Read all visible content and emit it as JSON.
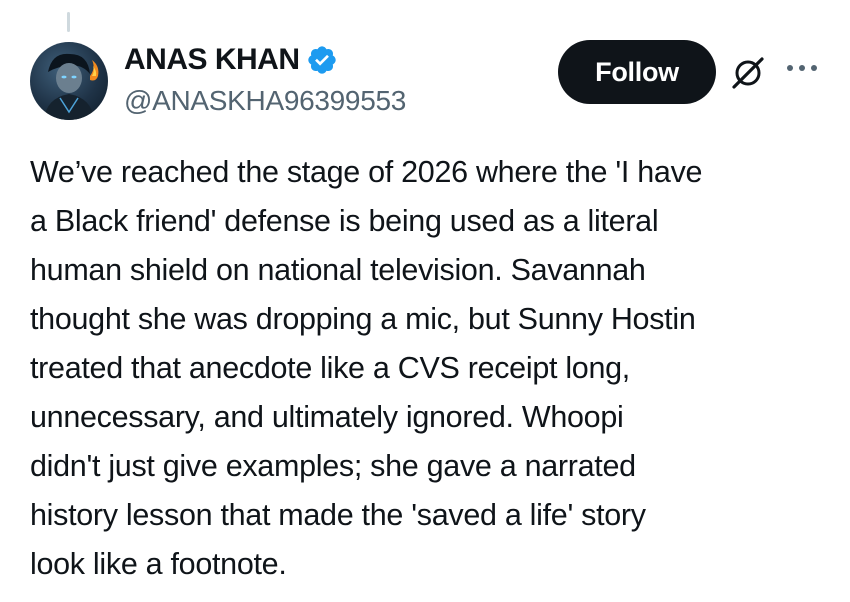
{
  "author": {
    "display_name": "ANAS KHAN",
    "handle": "@ANASKHA96399553",
    "verified": true,
    "verified_color": "#1d9bf0"
  },
  "actions": {
    "follow_label": "Follow",
    "follow_bg": "#0f1419",
    "icons": [
      "grok-icon",
      "more-icon"
    ]
  },
  "tweet": {
    "text": "We’ve reached the stage of 2026 where the 'I have\na Black friend' defense is being used as a literal\nhuman shield on national television. Savannah\nthought she was dropping a mic, but Sunny Hostin\ntreated that anecdote like a CVS receipt long,\nunnecessary, and ultimately ignored. Whoopi\ndidn't just give examples; she gave a narrated\nhistory lesson that made the 'saved a life' story\nlook like a footnote."
  }
}
